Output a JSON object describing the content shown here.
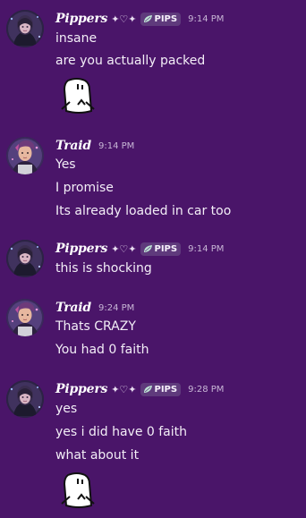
{
  "colors": {
    "background": "#4a1569",
    "text": "#f3eef7",
    "timestamp": "#c8b6d6",
    "tag_bg": "#5f3a7c"
  },
  "messages": [
    {
      "author": "Pippers",
      "decoration": "✦♡✦",
      "tag": "PIPS",
      "time": "9:14 PM",
      "lines": [
        "insane",
        "are you actually packed"
      ],
      "sticker": "flork-clock-sticker"
    },
    {
      "author": "Traid",
      "time": "9:14 PM",
      "lines": [
        "Yes",
        "I promise",
        "Its already loaded in car too"
      ]
    },
    {
      "author": "Pippers",
      "decoration": "✦♡✦",
      "tag": "PIPS",
      "time": "9:14 PM",
      "lines": [
        "this is shocking"
      ]
    },
    {
      "author": "Traid",
      "time": "9:24 PM",
      "lines": [
        "Thats CRAZY",
        "You had 0 faith"
      ]
    },
    {
      "author": "Pippers",
      "decoration": "✦♡✦",
      "tag": "PIPS",
      "time": "9:28 PM",
      "lines": [
        "yes",
        "yes i did have 0 faith",
        "what about it"
      ],
      "sticker": "flork-clock-sticker"
    }
  ]
}
